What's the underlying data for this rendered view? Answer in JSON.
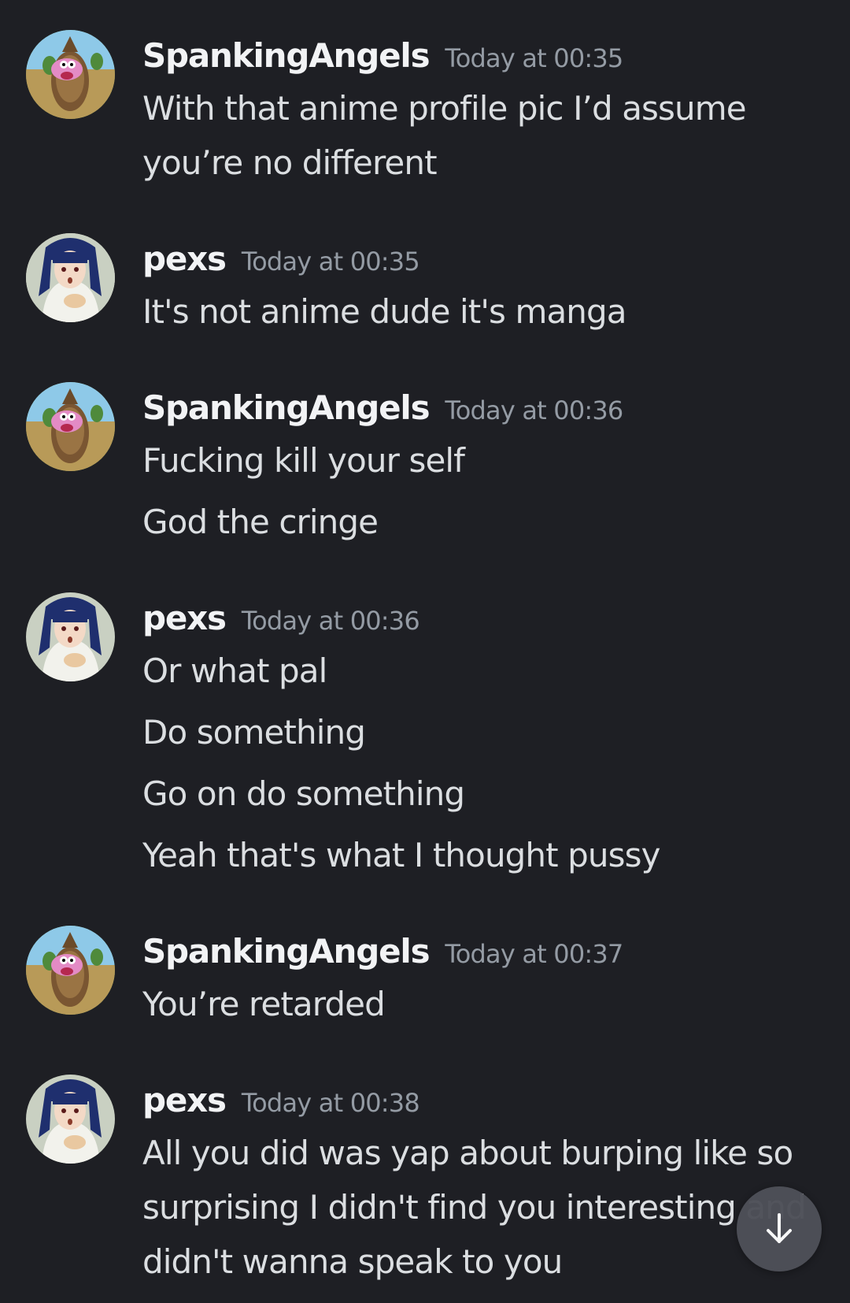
{
  "messages": [
    {
      "author": "SpankingAngels",
      "timestamp": "Today at 00:35",
      "lines": [
        "With that anime profile pic I’d assume",
        "you’re no different"
      ]
    },
    {
      "author": "pexs",
      "timestamp": "Today at 00:35",
      "lines": [
        "It's not anime dude it's manga"
      ]
    },
    {
      "author": "SpankingAngels",
      "timestamp": "Today at 00:36",
      "lines": [
        "Fucking kill your self",
        "God the cringe"
      ]
    },
    {
      "author": "pexs",
      "timestamp": "Today at 00:36",
      "lines": [
        "Or what pal",
        "Do something",
        "Go on do something",
        "Yeah that's what I thought pussy"
      ]
    },
    {
      "author": "SpankingAngels",
      "timestamp": "Today at 00:37",
      "lines": [
        "You’re retarded"
      ]
    },
    {
      "author": "pexs",
      "timestamp": "Today at 00:38",
      "lines": [
        "All you did was yap about burping like so",
        "surprising I didn't find you interesting and",
        "didn't wanna speak to you"
      ]
    }
  ],
  "scroll_button": {
    "icon": "arrow-down-icon"
  },
  "colors": {
    "background": "#1e1f24",
    "username": "#f2f3f5",
    "timestamp": "#949ba4",
    "message_text": "#dbdee1",
    "scroll_button": "#4e5058"
  }
}
